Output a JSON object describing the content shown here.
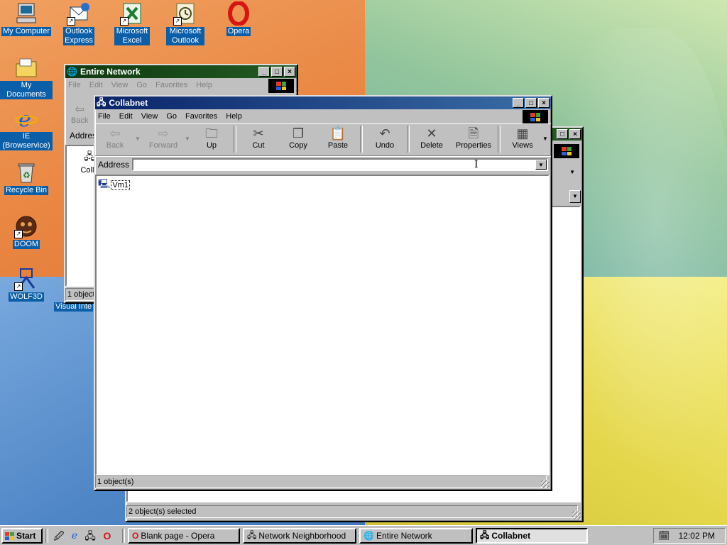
{
  "desktop": {
    "icons": [
      {
        "label": "My Computer"
      },
      {
        "label": "Outlook Express"
      },
      {
        "label": "Microsoft Excel"
      },
      {
        "label": "Microsoft Outlook"
      },
      {
        "label": "Opera"
      },
      {
        "label": "My Documents"
      },
      {
        "label": "IE (Browservice)"
      },
      {
        "label": "Recycle Bin"
      },
      {
        "label": "DOOM"
      },
      {
        "label": "WOLF3D"
      },
      {
        "label": "Visual Inte"
      }
    ]
  },
  "windows": {
    "entire_network": {
      "title": "Entire Network",
      "menu": [
        "File",
        "Edit",
        "View",
        "Go",
        "Favorites",
        "Help"
      ],
      "back_label": "Back",
      "address_label": "Address",
      "item_label": "Colla",
      "status": "1 object"
    },
    "network_neighborhood": {
      "status": "2 object(s) selected"
    },
    "collabnet": {
      "title": "Collabnet",
      "menu": [
        "File",
        "Edit",
        "View",
        "Go",
        "Favorites",
        "Help"
      ],
      "toolbar": {
        "back": "Back",
        "forward": "Forward",
        "up": "Up",
        "cut": "Cut",
        "copy": "Copy",
        "paste": "Paste",
        "undo": "Undo",
        "delete": "Delete",
        "properties": "Properties",
        "views": "Views"
      },
      "address_label": "Address",
      "address_value": "",
      "items": [
        {
          "label": "Vm1"
        }
      ],
      "status": "1 object(s)"
    }
  },
  "taskbar": {
    "start_label": "Start",
    "tasks": [
      {
        "label": "Blank page - Opera"
      },
      {
        "label": "Network Neighborhood"
      },
      {
        "label": "Entire Network"
      },
      {
        "label": "Collabnet"
      }
    ],
    "clock": "12:02 PM"
  },
  "colors": {
    "active_title": "#0a246a",
    "inactive_title": "#0f3a10",
    "icon_label_bg": "#0b5ea8",
    "face": "#c0c0c0"
  }
}
